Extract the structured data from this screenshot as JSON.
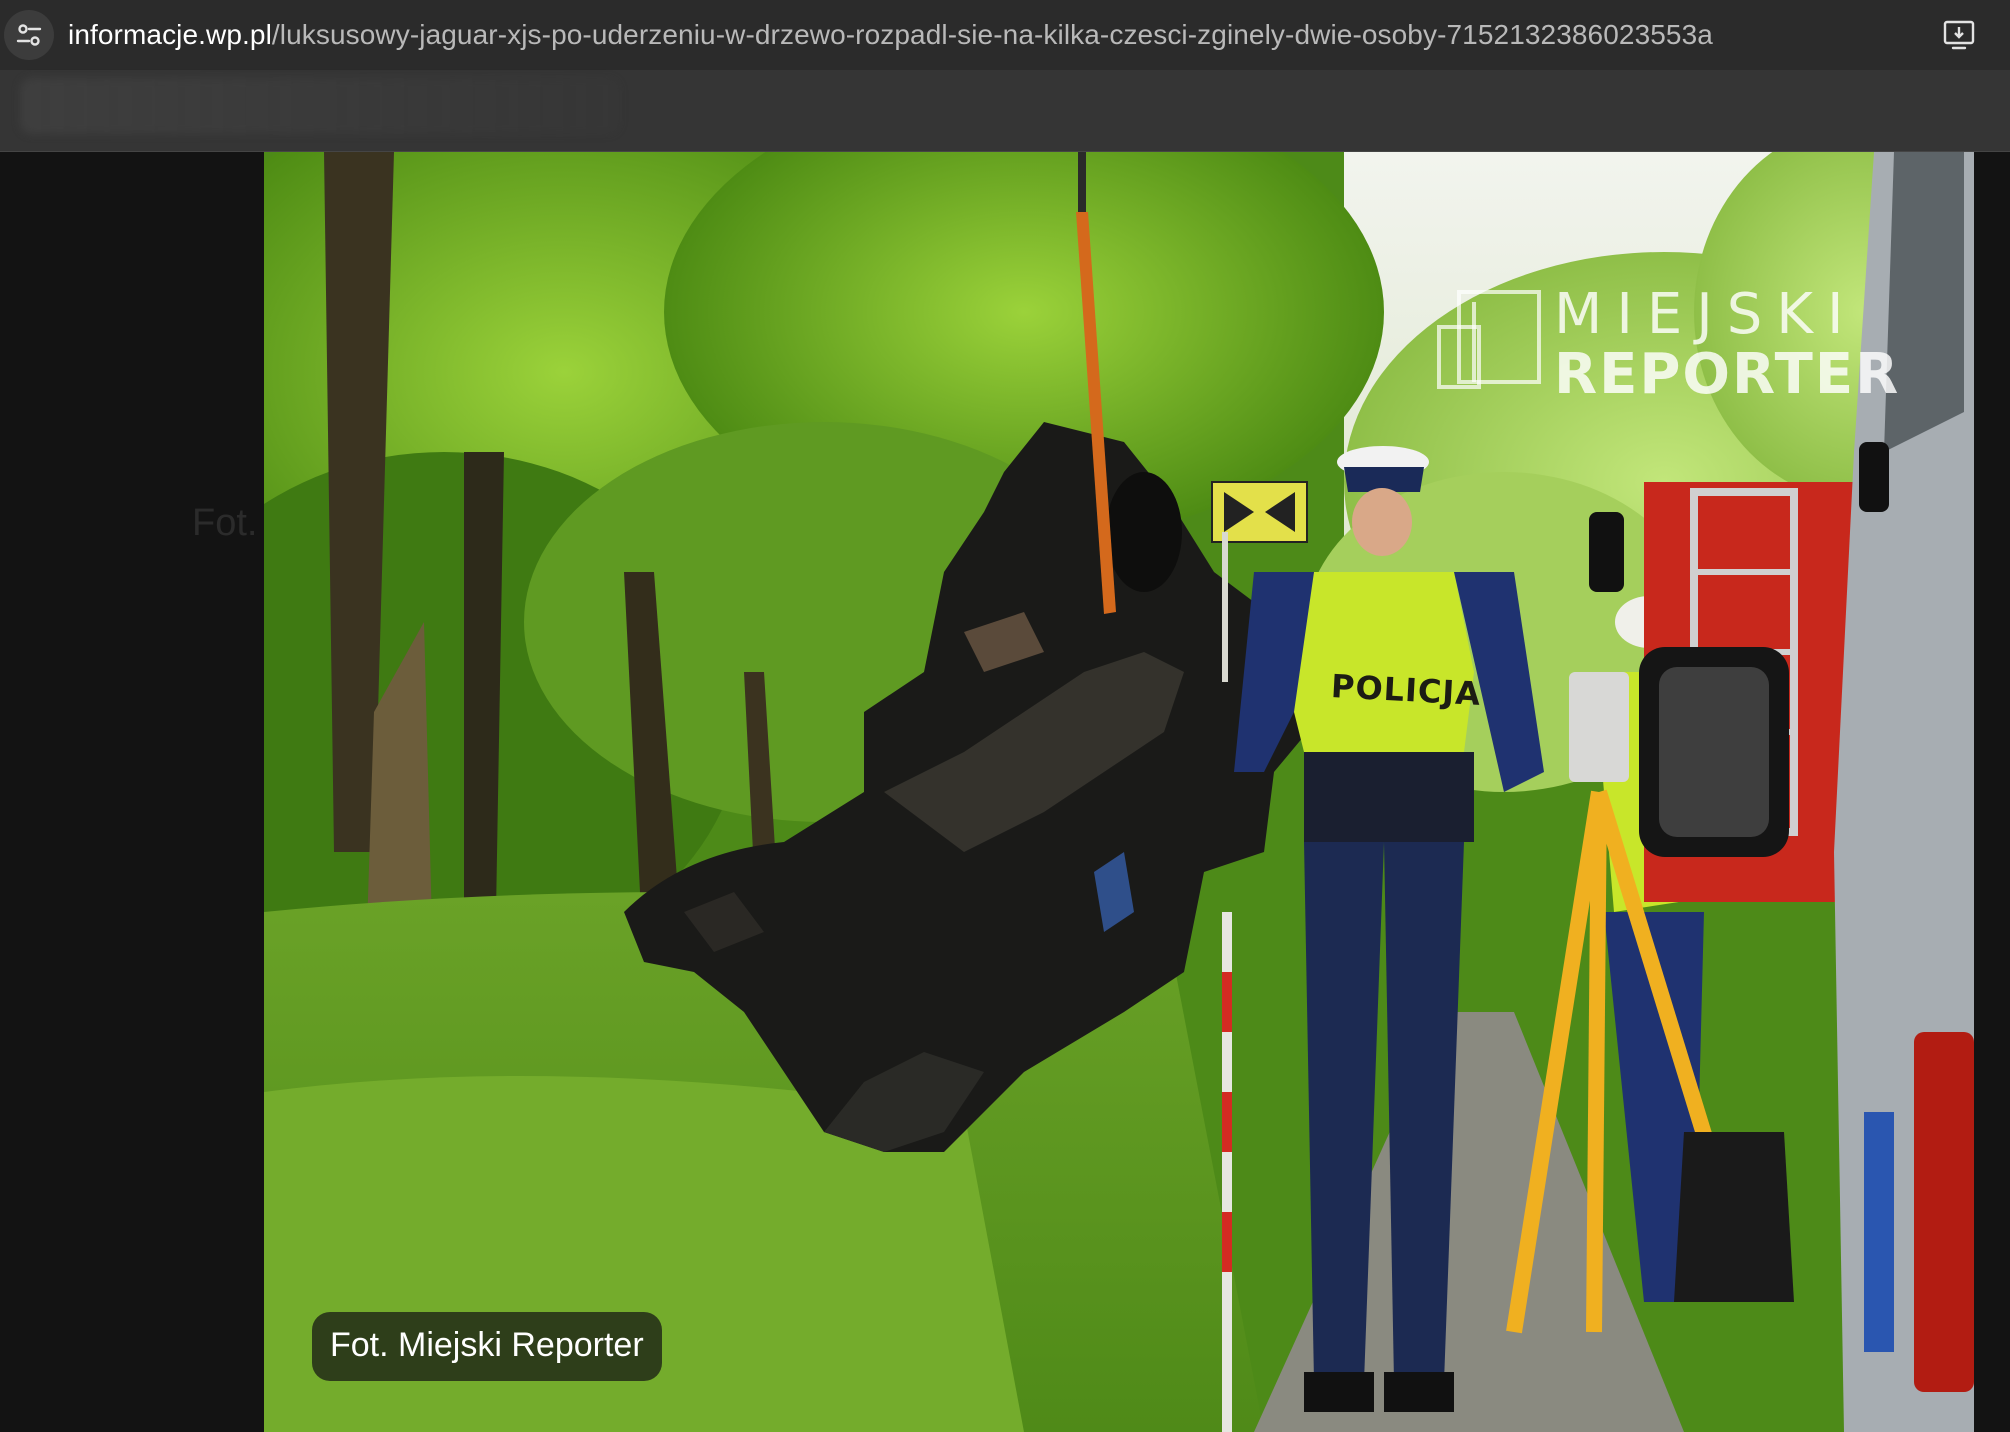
{
  "browser": {
    "url_domain": "informacje.wp.pl",
    "url_path": "/luksusowy-jaguar-xjs-po-uderzeniu-w-drzewo-rozpadl-sie-na-kilka-czesci-zginely-dwie-osoby-7152132386023553a",
    "site_info_icon": "tune-icon",
    "install_icon": "install-app-icon"
  },
  "page": {
    "caption_behind": "Fot.",
    "photo_caption": "Fot. Miejski Reporter",
    "watermark_line1": "MIEJSKI",
    "watermark_line2": "REPORTER",
    "vest_text": "POLICJA"
  },
  "colors": {
    "address_bar": "#2b2b2b",
    "page_background": "#131313",
    "foliage": "#5c8c1c",
    "hi_vis": "#c8e62a"
  }
}
